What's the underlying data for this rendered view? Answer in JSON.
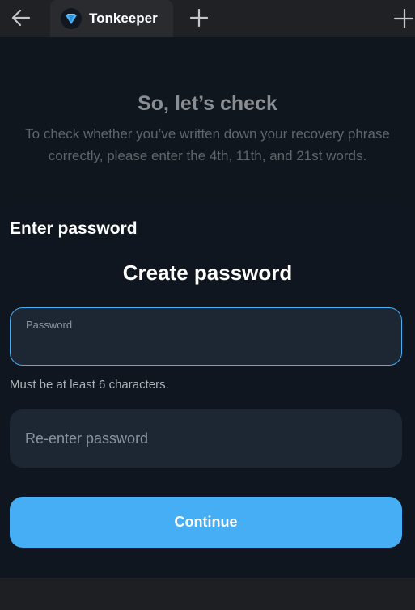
{
  "browser": {
    "tab_title": "Tonkeeper",
    "tab_icon": "tonkeeper-diamond-icon",
    "accent": "#45aef5"
  },
  "background_screen": {
    "title": "So, let’s check",
    "description": "To check whether you’ve written down your recovery phrase correctly, please enter the 4th, 11th, and  21st words."
  },
  "sheet": {
    "heading": "Enter password",
    "title": "Create password",
    "password_field": {
      "label": "Password",
      "value": ""
    },
    "hint": "Must be at least 6 characters.",
    "reenter_field": {
      "placeholder": "Re-enter password",
      "value": ""
    },
    "continue_label": "Continue"
  },
  "colors": {
    "primary_button": "#45aef5",
    "field_background": "#1d2633",
    "sheet_background": "#10161f"
  }
}
